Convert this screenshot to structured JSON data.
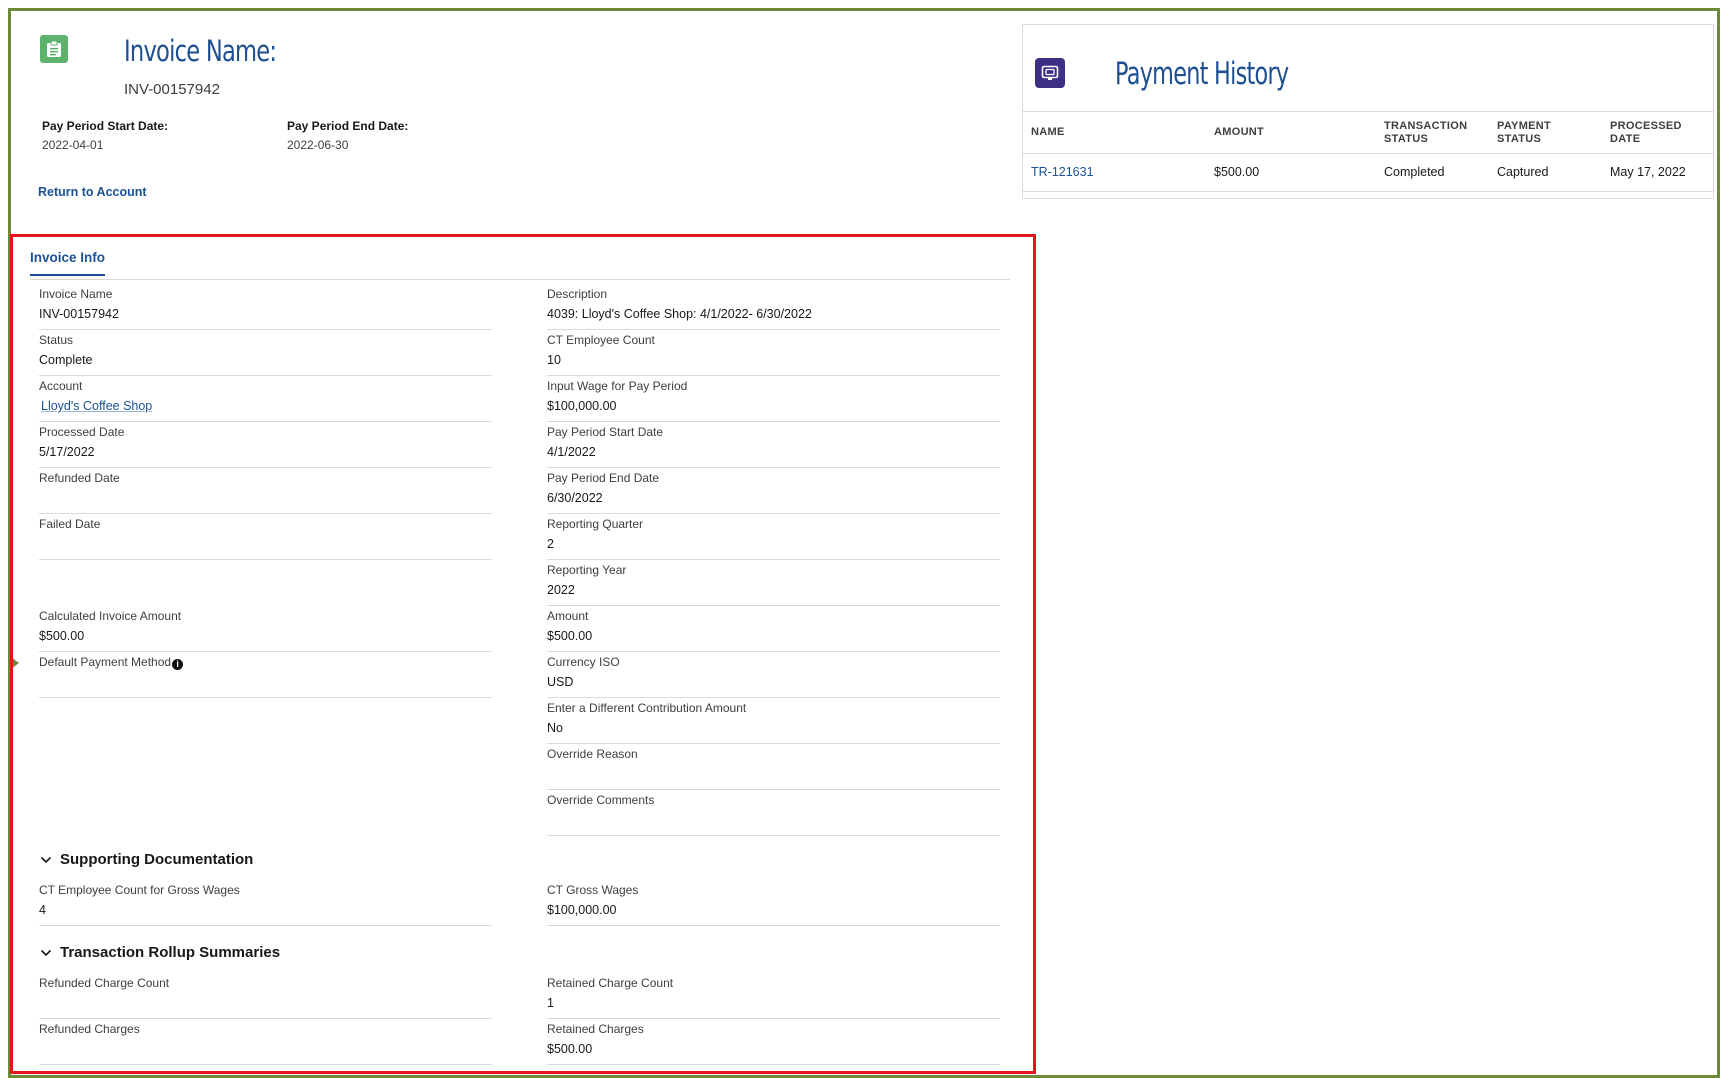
{
  "header": {
    "title": "Invoice Name:",
    "invoice_name": "INV-00157942",
    "icon": "clipboard-icon",
    "pay_period_start_label": "Pay Period Start Date:",
    "pay_period_start_value": "2022-04-01",
    "pay_period_end_label": "Pay Period End Date:",
    "pay_period_end_value": "2022-06-30",
    "return_link": "Return to Account"
  },
  "payment_history": {
    "title": "Payment History",
    "icon": "receipt-icon",
    "columns": [
      "NAME",
      "AMOUNT",
      "TRANSACTION STATUS",
      "PAYMENT STATUS",
      "PROCESSED DATE"
    ],
    "rows": [
      {
        "name": "TR-121631",
        "amount": "$500.00",
        "transaction_status": "Completed",
        "payment_status": "Captured",
        "processed_date": "May 17, 2022"
      }
    ]
  },
  "invoice_info": {
    "tab_label": "Invoice Info",
    "left_fields": [
      {
        "label": "Invoice Name",
        "value": "INV-00157942"
      },
      {
        "label": "Status",
        "value": "Complete"
      },
      {
        "label": "Account",
        "value": "Lloyd's Coffee Shop"
      },
      {
        "label": "Processed Date",
        "value": "5/17/2022"
      },
      {
        "label": "Refunded Date",
        "value": ""
      },
      {
        "label": "Failed Date",
        "value": ""
      },
      {
        "label": "Calculated Invoice Amount",
        "value": "$500.00"
      },
      {
        "label": "Default Payment Method",
        "value": ""
      }
    ],
    "right_fields": [
      {
        "label": "Description",
        "value": "4039: Lloyd's Coffee Shop: 4/1/2022- 6/30/2022"
      },
      {
        "label": "CT Employee Count",
        "value": "10"
      },
      {
        "label": "Input Wage for Pay Period",
        "value": "$100,000.00"
      },
      {
        "label": "Pay Period Start Date",
        "value": "4/1/2022"
      },
      {
        "label": "Pay Period End Date",
        "value": "6/30/2022"
      },
      {
        "label": "Reporting Quarter",
        "value": "2"
      },
      {
        "label": "Reporting Year",
        "value": "2022"
      },
      {
        "label": "Amount",
        "value": "$500.00"
      },
      {
        "label": "Currency ISO",
        "value": "USD"
      },
      {
        "label": "Enter a Different Contribution Amount",
        "value": "No"
      },
      {
        "label": "Override Reason",
        "value": ""
      },
      {
        "label": "Override Comments",
        "value": ""
      }
    ]
  },
  "supporting_documentation": {
    "title": "Supporting Documentation",
    "fields": [
      {
        "label": "CT Employee Count for Gross Wages",
        "value": "4"
      },
      {
        "label": "CT Gross Wages",
        "value": "$100,000.00"
      }
    ]
  },
  "transaction_rollup": {
    "title": "Transaction Rollup Summaries",
    "fields": [
      {
        "label": "Refunded Charge Count",
        "value": ""
      },
      {
        "label": "Retained Charge Count",
        "value": "1"
      },
      {
        "label": "Refunded Charges",
        "value": ""
      },
      {
        "label": "Retained Charges",
        "value": "$500.00"
      }
    ]
  },
  "colors": {
    "frame": "#6a8a3a",
    "highlight": "#e4151b",
    "link": "#1b5297",
    "header_icon": "#5eb36c",
    "payment_icon": "#3c3085"
  }
}
